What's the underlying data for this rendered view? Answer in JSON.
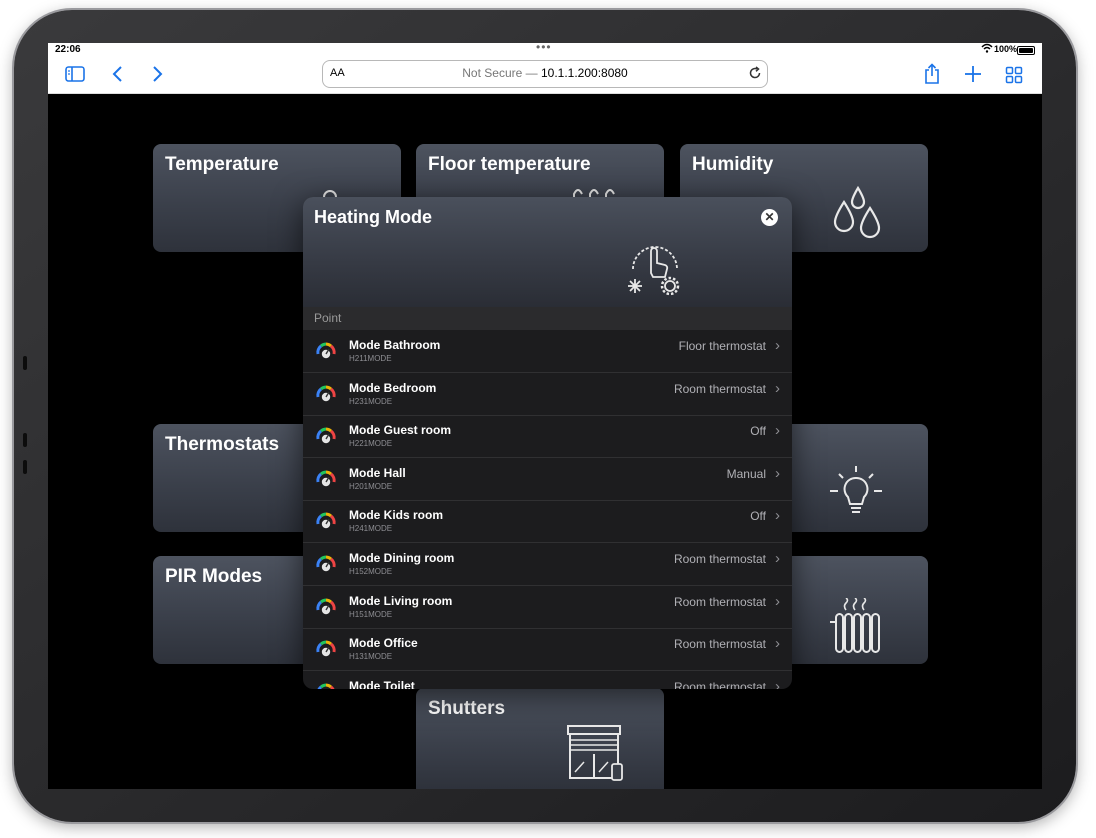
{
  "status": {
    "time": "22:06",
    "battery": "100%"
  },
  "browser": {
    "url_prefix": "Not Secure — ",
    "url": "10.1.1.200:8080",
    "text_size_label": "AA"
  },
  "tiles": [
    {
      "title": "Temperature"
    },
    {
      "title": "Floor temperature"
    },
    {
      "title": "Humidity"
    },
    {
      "title": "Thermostats"
    },
    {
      "title": "PIR Modes"
    },
    {
      "title": "Shutters"
    }
  ],
  "modal": {
    "title": "Heating Mode",
    "section": "Point",
    "rows": [
      {
        "name": "Mode Bathroom",
        "code": "H211MODE",
        "value": "Floor thermostat"
      },
      {
        "name": "Mode Bedroom",
        "code": "H231MODE",
        "value": "Room thermostat"
      },
      {
        "name": "Mode Guest room",
        "code": "H221MODE",
        "value": "Off"
      },
      {
        "name": "Mode Hall",
        "code": "H201MODE",
        "value": "Manual"
      },
      {
        "name": "Mode Kids room",
        "code": "H241MODE",
        "value": "Off"
      },
      {
        "name": "Mode Dining room",
        "code": "H152MODE",
        "value": "Room thermostat"
      },
      {
        "name": "Mode Living room",
        "code": "H151MODE",
        "value": "Room thermostat"
      },
      {
        "name": "Mode Office",
        "code": "H131MODE",
        "value": "Room thermostat"
      },
      {
        "name": "Mode Toilet",
        "code": "",
        "value": "Room thermostat"
      }
    ]
  },
  "colors": {
    "accent": "#1a73e8",
    "tile": "#444a55",
    "modal_bg": "#1c1c1e"
  }
}
